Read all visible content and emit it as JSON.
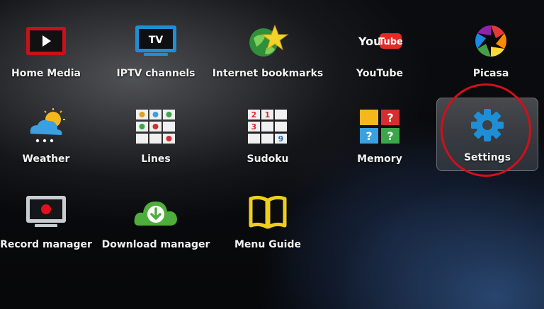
{
  "menu": {
    "items": [
      {
        "label": "Home Media",
        "icon": "home-media-icon"
      },
      {
        "label": "IPTV channels",
        "icon": "tv-icon"
      },
      {
        "label": "Internet bookmarks",
        "icon": "globe-star-icon"
      },
      {
        "label": "YouTube",
        "icon": "youtube-icon"
      },
      {
        "label": "Picasa",
        "icon": "picasa-icon"
      },
      {
        "label": "Weather",
        "icon": "weather-icon"
      },
      {
        "label": "Lines",
        "icon": "lines-game-icon"
      },
      {
        "label": "Sudoku",
        "icon": "sudoku-icon"
      },
      {
        "label": "Memory",
        "icon": "memory-game-icon"
      },
      {
        "label": "Settings",
        "icon": "gear-icon",
        "selected": true
      },
      {
        "label": "Record manager",
        "icon": "record-icon"
      },
      {
        "label": "Download manager",
        "icon": "download-cloud-icon"
      },
      {
        "label": "Menu Guide",
        "icon": "book-icon"
      }
    ]
  },
  "icons": {
    "tv_text": "TV",
    "youtube_you": "You",
    "youtube_tube": "Tube",
    "sudoku_digits": [
      "2",
      "1",
      "3",
      "9"
    ],
    "memory_marks": [
      "?",
      "?",
      "?"
    ]
  },
  "colors": {
    "highlight_ring": "#d0101a",
    "accent_blue": "#1e8fd6",
    "youtube_red": "#e32a26",
    "download_green": "#4fae3b",
    "book_yellow": "#f0cf1c"
  }
}
